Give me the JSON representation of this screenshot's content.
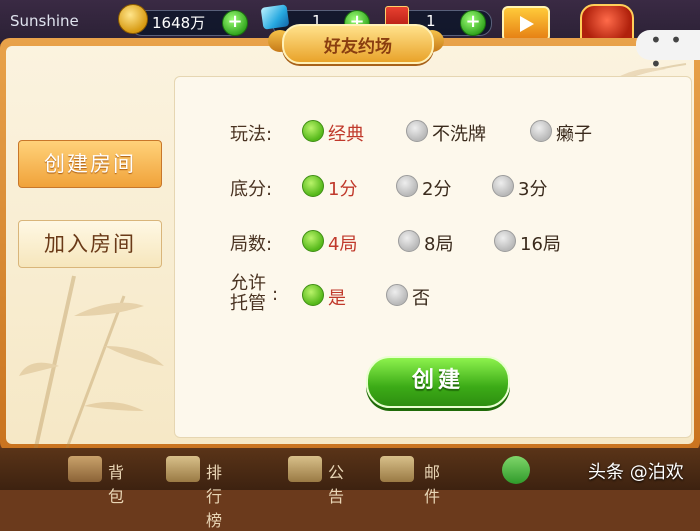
{
  "topbar": {
    "username": "Sunshine",
    "coins": "1648万",
    "gems": "1",
    "cards": "1"
  },
  "modal": {
    "title": "好友约场",
    "close_icon": "more-dots-icon"
  },
  "side_tabs": [
    {
      "label": "创建房间",
      "active": true
    },
    {
      "label": "加入房间",
      "active": false
    }
  ],
  "options": [
    {
      "label": "玩法:",
      "choices": [
        {
          "text": "经典",
          "selected": true
        },
        {
          "text": "不洗牌",
          "selected": false
        },
        {
          "text": "癞子",
          "selected": false
        }
      ]
    },
    {
      "label": "底分:",
      "choices": [
        {
          "text": "1分",
          "selected": true
        },
        {
          "text": "2分",
          "selected": false
        },
        {
          "text": "3分",
          "selected": false
        }
      ]
    },
    {
      "label": "局数:",
      "choices": [
        {
          "text": "4局",
          "selected": true
        },
        {
          "text": "8局",
          "selected": false
        },
        {
          "text": "16局",
          "selected": false
        }
      ]
    },
    {
      "label_line1": "允许",
      "label_line2": "托管",
      "label_suffix": ":",
      "choices": [
        {
          "text": "是",
          "selected": true
        },
        {
          "text": "否",
          "selected": false
        }
      ]
    }
  ],
  "create_button": "创建",
  "bottombar": {
    "items": [
      {
        "label": "背包",
        "icon": "bag-icon"
      },
      {
        "label": "排行榜",
        "icon": "ranking-icon"
      },
      {
        "label": "公告",
        "icon": "notice-icon"
      },
      {
        "label": "邮件",
        "icon": "mail-icon"
      },
      {
        "label": "",
        "icon": "share-icon"
      }
    ]
  },
  "watermark": "头条 @泊欢",
  "colors": {
    "accent_orange": "#f0a23a",
    "selected_text": "#c0392b",
    "create_green": "#3cab17"
  }
}
